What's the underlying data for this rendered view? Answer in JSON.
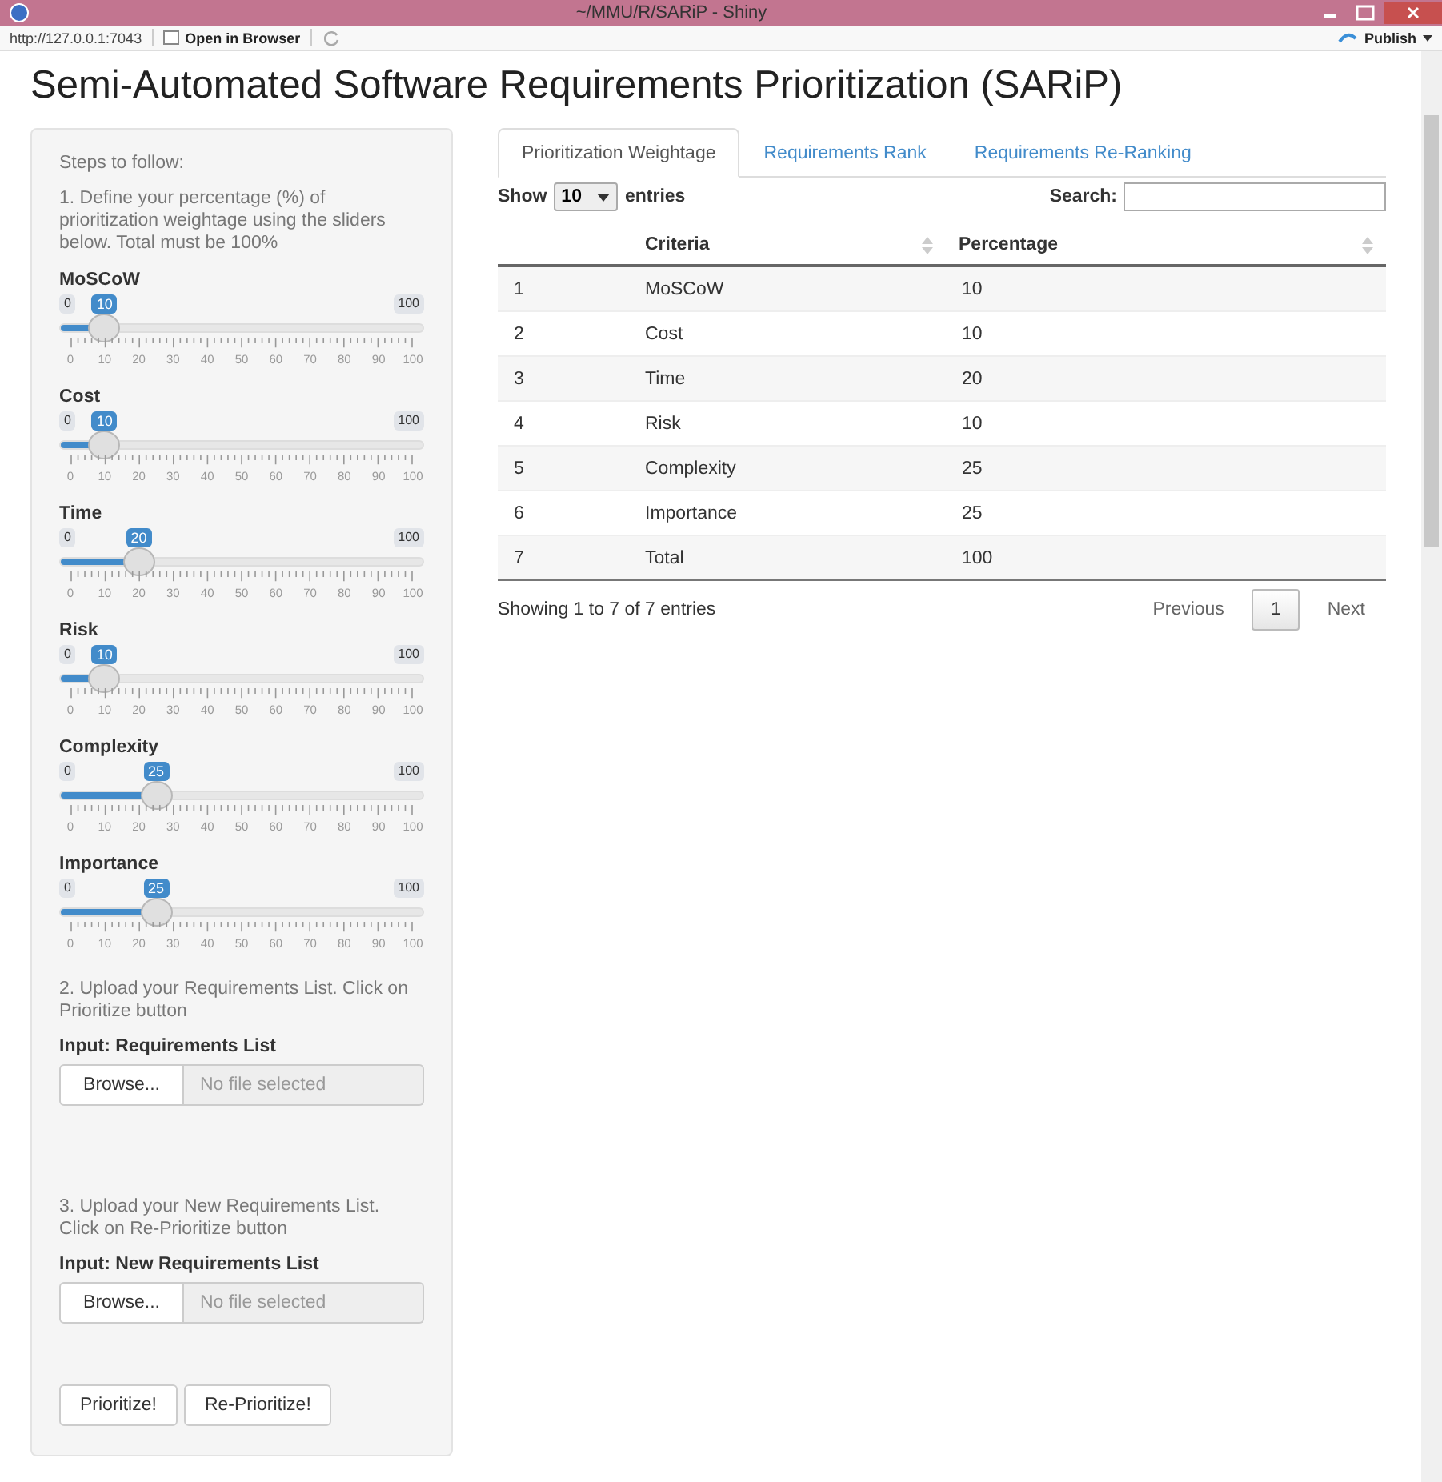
{
  "window": {
    "title": "~/MMU/R/SARiP - Shiny"
  },
  "toolbar": {
    "url": "http://127.0.0.1:7043",
    "open_button": "Open in Browser",
    "publish_button": "Publish"
  },
  "page": {
    "title": "Semi-Automated Software Requirements Prioritization (SARiP)"
  },
  "sidebar": {
    "heading": "Steps to follow:",
    "step_1": "1. Define your percentage (%) of prioritization weightage using the sliders below. Total must be 100%",
    "sliders": [
      {
        "label": "MoSCoW",
        "min": "0",
        "max": "100",
        "value": "10",
        "level": 0.1,
        "ticks": [
          "0",
          "10",
          "20",
          "30",
          "40",
          "50",
          "60",
          "70",
          "80",
          "90",
          "100"
        ]
      },
      {
        "label": "Cost",
        "min": "0",
        "max": "100",
        "value": "10",
        "level": 0.1,
        "ticks": [
          "0",
          "10",
          "20",
          "30",
          "40",
          "50",
          "60",
          "70",
          "80",
          "90",
          "100"
        ]
      },
      {
        "label": "Time",
        "min": "0",
        "max": "100",
        "value": "20",
        "level": 0.2,
        "ticks": [
          "0",
          "10",
          "20",
          "30",
          "40",
          "50",
          "60",
          "70",
          "80",
          "90",
          "100"
        ]
      },
      {
        "label": "Risk",
        "min": "0",
        "max": "100",
        "value": "10",
        "level": 0.1,
        "ticks": [
          "0",
          "10",
          "20",
          "30",
          "40",
          "50",
          "60",
          "70",
          "80",
          "90",
          "100"
        ]
      },
      {
        "label": "Complexity",
        "min": "0",
        "max": "100",
        "value": "25",
        "level": 0.25,
        "ticks": [
          "0",
          "10",
          "20",
          "30",
          "40",
          "50",
          "60",
          "70",
          "80",
          "90",
          "100"
        ]
      },
      {
        "label": "Importance",
        "min": "0",
        "max": "100",
        "value": "25",
        "level": 0.25,
        "ticks": [
          "0",
          "10",
          "20",
          "30",
          "40",
          "50",
          "60",
          "70",
          "80",
          "90",
          "100"
        ]
      }
    ],
    "step_2": "2. Upload your Requirements List. Click on Prioritize button",
    "upload_1": {
      "label": "Input: Requirements List",
      "button": "Browse...",
      "placeholder": "No file selected"
    },
    "step_3": "3. Upload your New Requirements List. Click on Re-Prioritize button",
    "upload_2": {
      "label": "Input: New Requirements List",
      "button": "Browse...",
      "placeholder": "No file selected"
    },
    "buttons": [
      "Prioritize!",
      "Re-Prioritize!"
    ]
  },
  "tabs": [
    {
      "label": "Prioritization Weightage",
      "selected": true
    },
    {
      "label": "Requirements Rank",
      "selected": false
    },
    {
      "label": "Requirements Re-Ranking",
      "selected": false
    }
  ],
  "table": {
    "show_label": "Show",
    "length_value": "10",
    "entries_label": "entries",
    "search_label": "Search:",
    "columns": [
      "",
      "Criteria",
      "Percentage"
    ],
    "rows": [
      [
        "1",
        "MoSCoW",
        "10"
      ],
      [
        "2",
        "Cost",
        "10"
      ],
      [
        "3",
        "Time",
        "20"
      ],
      [
        "4",
        "Risk",
        "10"
      ],
      [
        "5",
        "Complexity",
        "25"
      ],
      [
        "6",
        "Importance",
        "25"
      ],
      [
        "7",
        "Total",
        "100"
      ]
    ],
    "info": "Showing 1 to 7 of 7 entries",
    "pagination": [
      {
        "label": "Previous",
        "selected": false,
        "disabled": true
      },
      {
        "label": "1",
        "selected": true,
        "disabled": false
      },
      {
        "label": "Next",
        "selected": false,
        "disabled": true
      }
    ]
  }
}
